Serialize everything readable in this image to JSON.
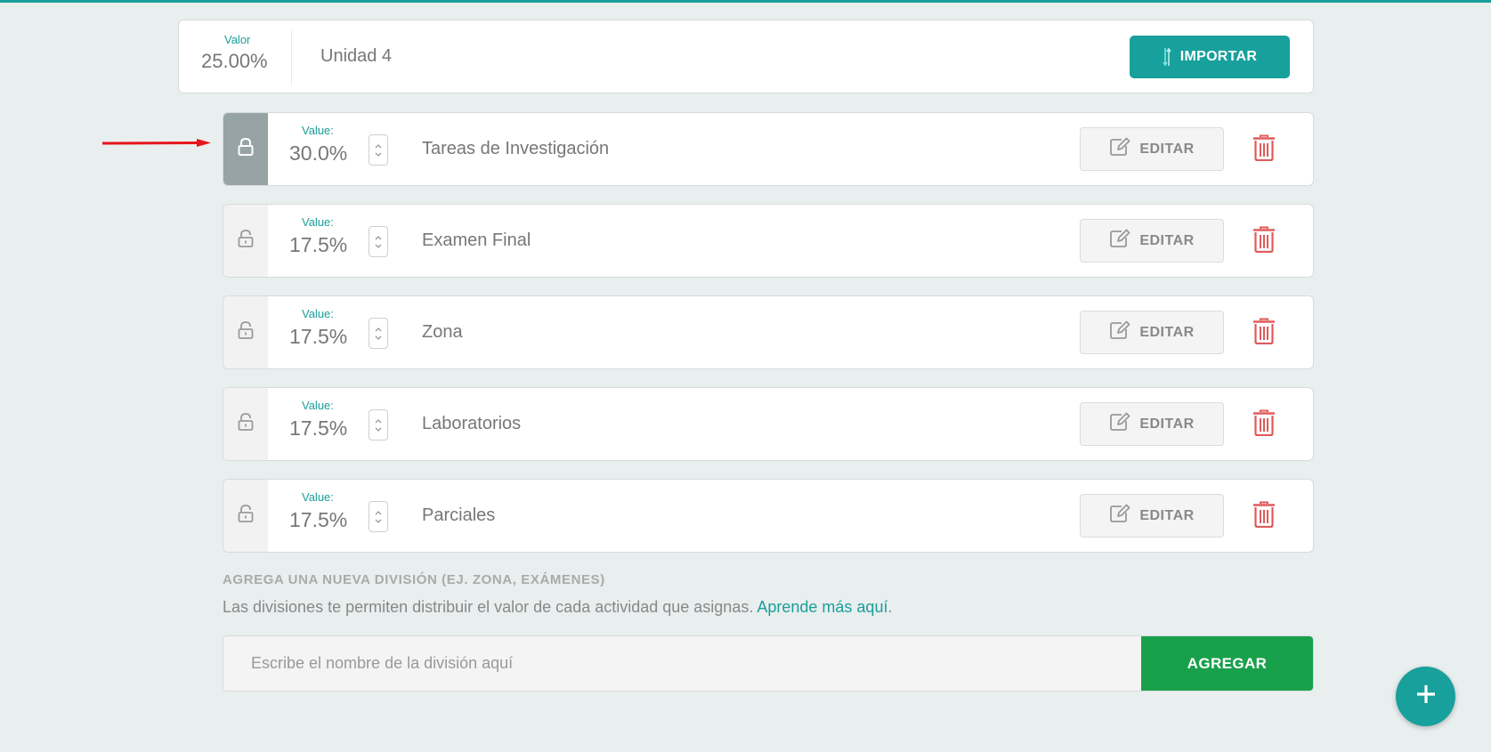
{
  "unit": {
    "value_label": "Valor",
    "value": "25.00%",
    "name": "Unidad 4",
    "import_label": "IMPORTAR"
  },
  "divisions": [
    {
      "value_label": "Value:",
      "value": "30.0%",
      "name": "Tareas de Investigación",
      "locked": true,
      "edit_label": "EDITAR"
    },
    {
      "value_label": "Value:",
      "value": "17.5%",
      "name": "Examen Final",
      "locked": false,
      "edit_label": "EDITAR"
    },
    {
      "value_label": "Value:",
      "value": "17.5%",
      "name": "Zona",
      "locked": false,
      "edit_label": "EDITAR"
    },
    {
      "value_label": "Value:",
      "value": "17.5%",
      "name": "Laboratorios",
      "locked": false,
      "edit_label": "EDITAR"
    },
    {
      "value_label": "Value:",
      "value": "17.5%",
      "name": "Parciales",
      "locked": false,
      "edit_label": "EDITAR"
    }
  ],
  "add_division": {
    "title": "AGREGA UNA NUEVA DIVISIÓN (EJ. ZONA, EXÁMENES)",
    "description": "Las divisiones te permiten distribuir el valor de cada actividad que asignas.",
    "learn_more": "Aprende más aquí",
    "period": ".",
    "placeholder": "Escribe el nombre de la división aquí",
    "button_label": "AGREGAR"
  },
  "colors": {
    "accent": "#18a09c",
    "add_button": "#19a04b",
    "locked_bg": "#96a4a5",
    "delete": "#e05a5a",
    "annotation_arrow": "#e8141c"
  },
  "icons": {
    "import": "import-arrows-icon",
    "lock_closed": "lock-closed-icon",
    "lock_open": "lock-open-icon",
    "stepper": "chevron-up-down-icon",
    "edit": "edit-icon",
    "delete": "trash-icon",
    "fab": "plus-icon",
    "annotation": "arrow-right-icon"
  }
}
